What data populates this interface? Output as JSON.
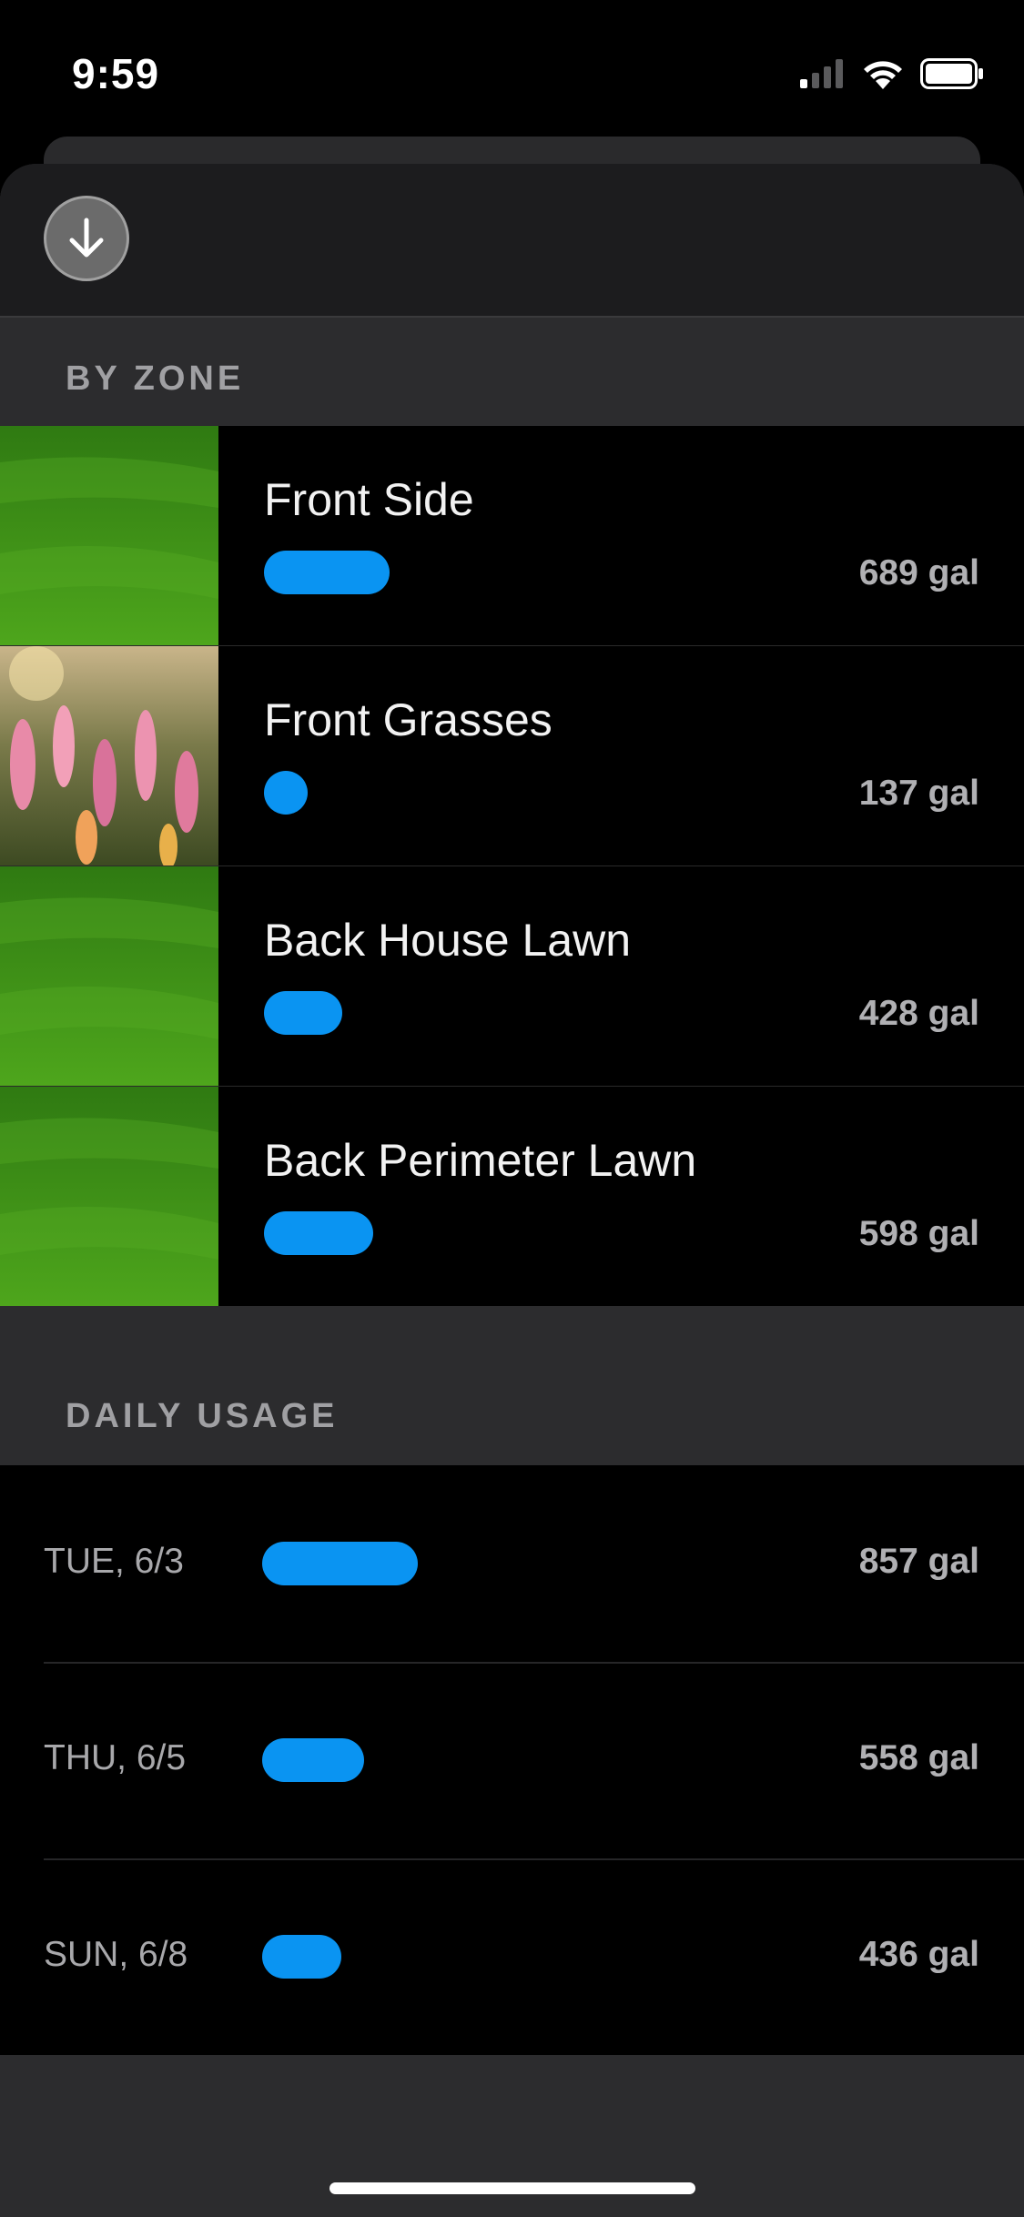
{
  "status_bar": {
    "time": "9:59"
  },
  "sheet": {
    "by_zone_title": "BY ZONE",
    "daily_usage_title": "DAILY USAGE",
    "zones": [
      {
        "name": "Front Side",
        "value": "689 gal",
        "gallons": 689,
        "image": "lawn"
      },
      {
        "name": "Front Grasses",
        "value": "137 gal",
        "gallons": 137,
        "image": "flowers"
      },
      {
        "name": "Back House Lawn",
        "value": "428 gal",
        "gallons": 428,
        "image": "lawn"
      },
      {
        "name": "Back Perimeter Lawn",
        "value": "598 gal",
        "gallons": 598,
        "image": "lawn"
      }
    ],
    "daily": [
      {
        "label": "TUE, 6/3",
        "value": "857 gal",
        "gallons": 857
      },
      {
        "label": "THU, 6/5",
        "value": "558 gal",
        "gallons": 558
      },
      {
        "label": "SUN, 6/8",
        "value": "436 gal",
        "gallons": 436
      }
    ]
  },
  "colors": {
    "accent": "#0a94f2",
    "background": "#000000",
    "sheet": "#2c2c2e"
  },
  "icons": {
    "close": "arrow-down-circle-icon",
    "signal": "cellular-signal-icon",
    "wifi": "wifi-icon",
    "battery": "battery-icon"
  }
}
